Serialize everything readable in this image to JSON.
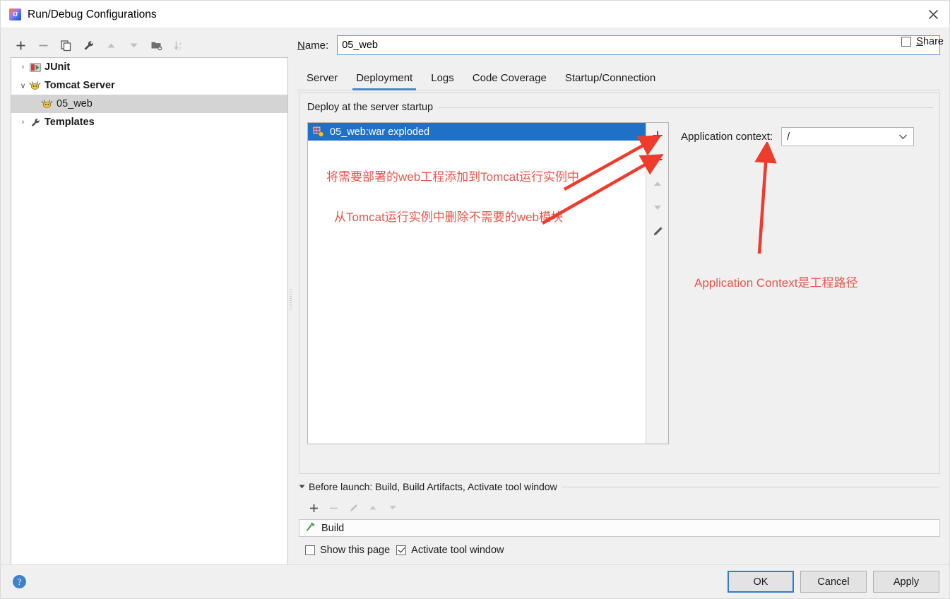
{
  "window": {
    "title": "Run/Debug Configurations",
    "app_icon": "intellij-idea-icon",
    "close_icon": "close-icon"
  },
  "left_toolbar": {
    "buttons": [
      {
        "name": "add-configuration-button",
        "icon": "plus-icon",
        "glyph": "+"
      },
      {
        "name": "remove-configuration-button",
        "icon": "minus-icon",
        "glyph": "−"
      },
      {
        "name": "copy-configuration-button",
        "icon": "copy-icon",
        "glyph": "❐"
      },
      {
        "name": "edit-templates-button",
        "icon": "wrench-icon",
        "glyph": "🔧"
      },
      {
        "name": "move-up-button",
        "icon": "arrow-up-icon",
        "glyph": "▲"
      },
      {
        "name": "move-down-button",
        "icon": "arrow-down-icon",
        "glyph": "▼"
      },
      {
        "name": "move-into-folder-button",
        "icon": "new-folder-icon",
        "glyph": "📁"
      },
      {
        "name": "sort-alphabetically-button",
        "icon": "sort-az-icon",
        "glyph": "↓"
      }
    ]
  },
  "tree": {
    "items": [
      {
        "label": "JUnit",
        "icon": "junit-icon",
        "expanded": false,
        "twisty": "›",
        "level": 0,
        "bold": true,
        "selected": false
      },
      {
        "label": "Tomcat Server",
        "icon": "tomcat-icon",
        "expanded": true,
        "twisty": "∨",
        "level": 0,
        "bold": true,
        "selected": false
      },
      {
        "label": "05_web",
        "icon": "tomcat-icon",
        "expanded": null,
        "twisty": "",
        "level": 1,
        "bold": false,
        "selected": true
      },
      {
        "label": "Templates",
        "icon": "wrench-icon",
        "expanded": false,
        "twisty": "›",
        "level": 0,
        "bold": true,
        "selected": false
      }
    ]
  },
  "name_field": {
    "label": "Name:",
    "label_mnemonic": "N",
    "value": "05_web",
    "placeholder": ""
  },
  "share": {
    "label": "Share",
    "label_mnemonic": "S",
    "checked": false
  },
  "tabs": [
    {
      "label": "Server",
      "active": false
    },
    {
      "label": "Deployment",
      "active": true
    },
    {
      "label": "Logs",
      "active": false
    },
    {
      "label": "Code Coverage",
      "active": false
    },
    {
      "label": "Startup/Connection",
      "active": false
    }
  ],
  "deployment": {
    "section_title": "Deploy at the server startup",
    "items": [
      {
        "label": "05_web:war exploded",
        "icon": "war-artifact-icon",
        "selected": true
      }
    ],
    "side_buttons": [
      {
        "name": "add-artifact-button",
        "icon": "plus-icon",
        "glyph": "+"
      },
      {
        "name": "remove-artifact-button",
        "icon": "minus-icon",
        "glyph": "−"
      },
      {
        "name": "move-artifact-up-button",
        "icon": "arrow-up-icon",
        "glyph": "▲"
      },
      {
        "name": "move-artifact-down-button",
        "icon": "arrow-down-icon",
        "glyph": "▼"
      },
      {
        "name": "edit-artifact-button",
        "icon": "pencil-icon",
        "glyph": "✎"
      }
    ]
  },
  "application_context": {
    "label": "Application context:",
    "value": "/",
    "options": [
      "/"
    ]
  },
  "annotations": [
    {
      "name": "annotation-add-web-module",
      "text": "将需要部署的web工程添加到Tomcat运行实例中",
      "color": "#e8564b"
    },
    {
      "name": "annotation-remove-web-module",
      "text": "从Tomcat运行实例中删除不需要的web模块",
      "color": "#e8564b"
    },
    {
      "name": "annotation-application-context",
      "text": "Application Context是工程路径",
      "color": "#e8564b"
    }
  ],
  "before_launch": {
    "title": "Before launch: Build, Build Artifacts, Activate tool window",
    "title_mnemonic": "B",
    "toolbar": [
      {
        "name": "add-task-button",
        "icon": "plus-icon",
        "glyph": "+",
        "enabled": true
      },
      {
        "name": "remove-task-button",
        "icon": "minus-icon",
        "glyph": "−",
        "enabled": false
      },
      {
        "name": "edit-task-button",
        "icon": "pencil-icon",
        "glyph": "✎",
        "enabled": false
      },
      {
        "name": "move-task-up-button",
        "icon": "arrow-up-icon",
        "glyph": "▲",
        "enabled": false
      },
      {
        "name": "move-task-down-button",
        "icon": "arrow-down-icon",
        "glyph": "▼",
        "enabled": false
      }
    ],
    "items": [
      {
        "label": "Build",
        "icon": "hammer-icon"
      }
    ],
    "checkboxes": [
      {
        "name": "show-this-page-checkbox",
        "label": "Show this page",
        "checked": false
      },
      {
        "name": "activate-tool-window-checkbox",
        "label": "Activate tool window",
        "checked": true
      }
    ]
  },
  "footer": {
    "help_label": "?",
    "buttons": [
      {
        "name": "ok-button",
        "label": "OK",
        "primary": true
      },
      {
        "name": "cancel-button",
        "label": "Cancel",
        "primary": false
      },
      {
        "name": "apply-button",
        "label": "Apply",
        "primary": false
      }
    ]
  }
}
